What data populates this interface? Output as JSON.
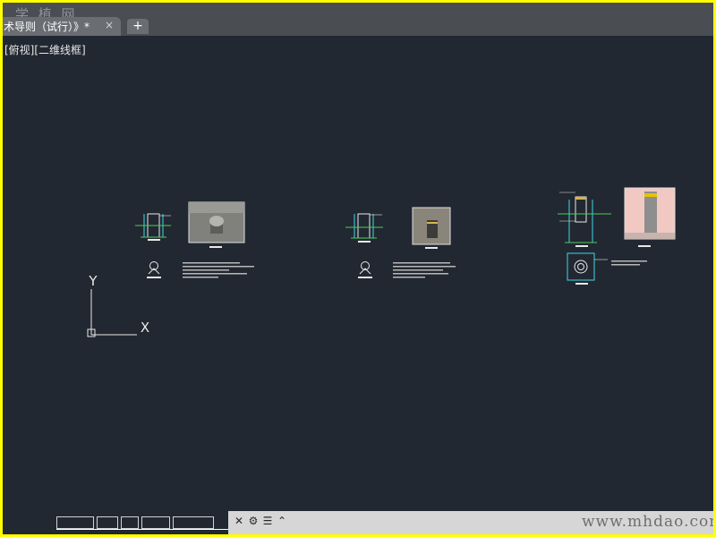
{
  "window": {
    "watermark": "学 植 网",
    "tab_title": "术导则（试行）》*",
    "tab_close_glyph": "×",
    "tab_add_glyph": "+"
  },
  "viewport": {
    "view_label": "[俯视][二维线框]"
  },
  "ucs": {
    "y_label": "Y",
    "x_label": "X"
  },
  "statusbar": {
    "url_watermark": "www.mhdao.com"
  },
  "colors": {
    "frame": "#ffff00",
    "canvas": "#222831",
    "cyan_line": "#3fd8e8",
    "green_line": "#4ccd5a",
    "white_line": "#e8e8e8"
  }
}
